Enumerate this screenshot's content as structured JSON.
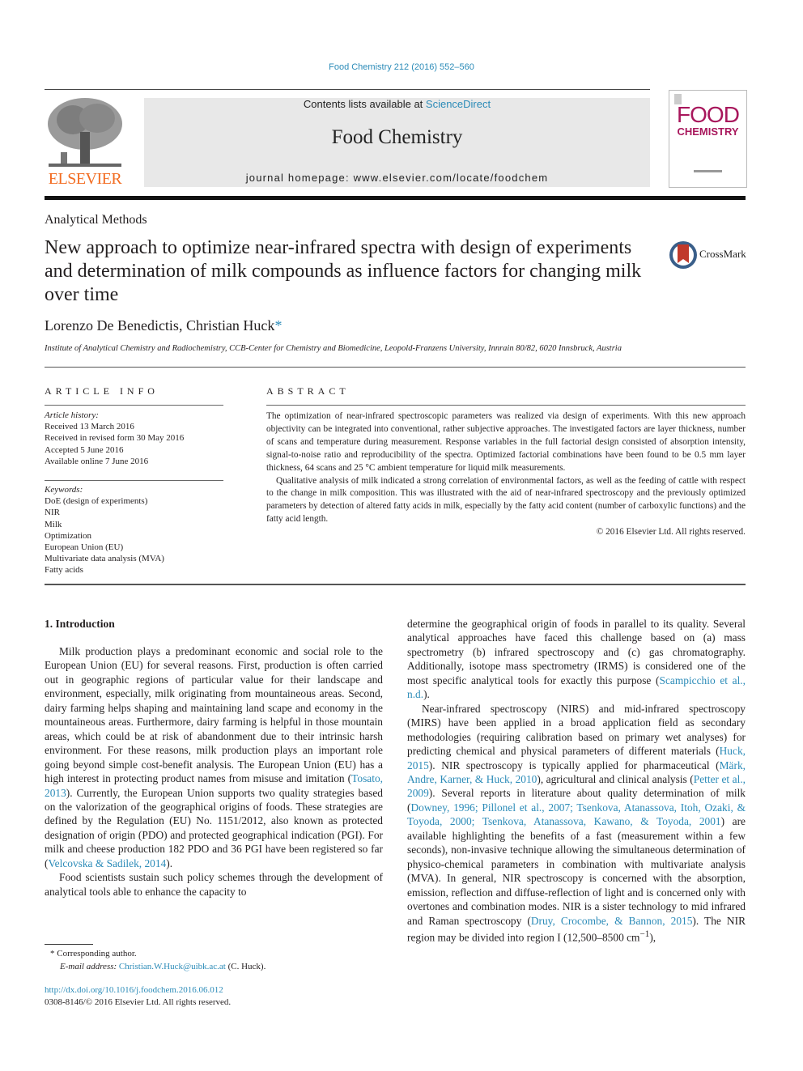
{
  "header": {
    "journal_ref": "Food Chemistry 212 (2016) 552–560",
    "contents_prefix": "Contents lists available at ",
    "contents_link": "ScienceDirect",
    "journal_title": "Food Chemistry",
    "homepage": "journal homepage: www.elsevier.com/locate/foodchem",
    "publisher_logo_text": "ELSEVIER",
    "cover_word1": "FOOD",
    "cover_word2": "CHEMISTRY",
    "crossmark_label": "CrossMark"
  },
  "article": {
    "section": "Analytical Methods",
    "title": "New approach to optimize near-infrared spectra with design of experiments and determination of milk compounds as influence factors for changing milk over time",
    "authors": "Lorenzo De Benedictis, Christian Huck",
    "author_mark": "*",
    "affiliation": "Institute of Analytical Chemistry and Radiochemistry, CCB-Center for Chemistry and Biomedicine, Leopold-Franzens University, Innrain 80/82, 6020 Innsbruck, Austria"
  },
  "article_info": {
    "heading": "ARTICLE INFO",
    "history_label": "Article history:",
    "history": [
      "Received 13 March 2016",
      "Received in revised form 30 May 2016",
      "Accepted 5 June 2016",
      "Available online 7 June 2016"
    ],
    "keywords_label": "Keywords:",
    "keywords": [
      "DoE (design of experiments)",
      "NIR",
      "Milk",
      "Optimization",
      "European Union (EU)",
      "Multivariate data analysis (MVA)",
      "Fatty acids"
    ]
  },
  "abstract": {
    "heading": "ABSTRACT",
    "p1": "The optimization of near-infrared spectroscopic parameters was realized via design of experiments. With this new approach objectivity can be integrated into conventional, rather subjective approaches. The investigated factors are layer thickness, number of scans and temperature during measurement. Response variables in the full factorial design consisted of absorption intensity, signal-to-noise ratio and reproducibility of the spectra. Optimized factorial combinations have been found to be 0.5 mm layer thickness, 64 scans and 25 °C ambient temperature for liquid milk measurements.",
    "p2": "Qualitative analysis of milk indicated a strong correlation of environmental factors, as well as the feeding of cattle with respect to the change in milk composition. This was illustrated with the aid of near-infrared spectroscopy and the previously optimized parameters by detection of altered fatty acids in milk, especially by the fatty acid content (number of carboxylic functions) and the fatty acid length.",
    "copyright": "© 2016 Elsevier Ltd. All rights reserved."
  },
  "body": {
    "intro_heading": "1. Introduction",
    "left_p1_a": "Milk production plays a predominant economic and social role to the European Union (EU) for several reasons. First, production is often carried out in geographic regions of particular value for their landscape and environment, especially, milk originating from mountaineous areas. Second, dairy farming helps shaping and maintaining land scape and economy in the mountaineous areas. Furthermore, dairy farming is helpful in those mountain areas, which could be at risk of abandonment due to their intrinsic harsh environment. For these reasons, milk production plays an important role going beyond simple cost-benefit analysis. The European Union (EU) has a high interest in protecting product names from misuse and imitation (",
    "cite_tosato": "Tosato, 2013",
    "left_p1_b": "). Currently, the European Union supports two quality strategies based on the valorization of the geographical origins of foods. These strategies are defined by the Regulation (EU) No. 1151/2012, also known as protected designation of origin (PDO) and protected geographical indication (PGI). For milk and cheese production 182 PDO and 36 PGI have been registered so far (",
    "cite_velcovska": "Velcovska & Sadilek, 2014",
    "left_p1_c": ").",
    "left_p2": "Food scientists sustain such policy schemes through the development of analytical tools able to enhance the capacity to",
    "right_p1_a": "determine the geographical origin of foods in parallel to its quality. Several analytical approaches have faced this challenge based on (a) mass spectrometry (b) infrared spectroscopy and (c) gas chromatography. Additionally, isotope mass spectrometry (IRMS) is considered one of the most specific analytical tools for exactly this purpose (",
    "cite_scampicchio": "Scampicchio et al., n.d.",
    "right_p1_b": ").",
    "right_p2_a": "Near-infrared spectroscopy (NIRS) and mid-infrared spectroscopy (MIRS) have been applied in a broad application field as secondary methodologies (requiring calibration based on primary wet analyses) for predicting chemical and physical parameters of different materials (",
    "cite_huck": "Huck, 2015",
    "right_p2_b": "). NIR spectroscopy is typically applied for pharmaceutical (",
    "cite_mark": "Märk, Andre, Karner, & Huck, 2010",
    "right_p2_c": "), agricultural and clinical analysis (",
    "cite_petter": "Petter et al., 2009",
    "right_p2_d": "). Several reports in literature about quality determination of milk (",
    "cite_multi": "Downey, 1996; Pillonel et al., 2007; Tsenkova, Atanassova, Itoh, Ozaki, & Toyoda, 2000; Tsenkova, Atanassova, Kawano, & Toyoda, 2001",
    "right_p2_e": ") are available highlighting the benefits of a fast (measurement within a few seconds), non-invasive technique allowing the simultaneous determination of physico-chemical parameters in combination with multivariate analysis (MVA). In general, NIR spectroscopy is concerned with the absorption, emission, reflection and diffuse-reflection of light and is concerned only with overtones and combination modes. NIR is a sister technology to mid infrared and Raman spectroscopy (",
    "cite_druy": "Druy, Crocombe, & Bannon, 2015",
    "right_p2_f": "). The NIR region may be divided into region I (12,500–8500 cm",
    "superscript": "−1",
    "right_p2_g": "),"
  },
  "footer": {
    "star": "*",
    "corresponding": "Corresponding author.",
    "email_label": "E-mail address:",
    "email": "Christian.W.Huck@uibk.ac.at",
    "email_suffix": " (C. Huck).",
    "doi": "http://dx.doi.org/10.1016/j.foodchem.2016.06.012",
    "issn": "0308-8146/© 2016 Elsevier Ltd. All rights reserved."
  }
}
